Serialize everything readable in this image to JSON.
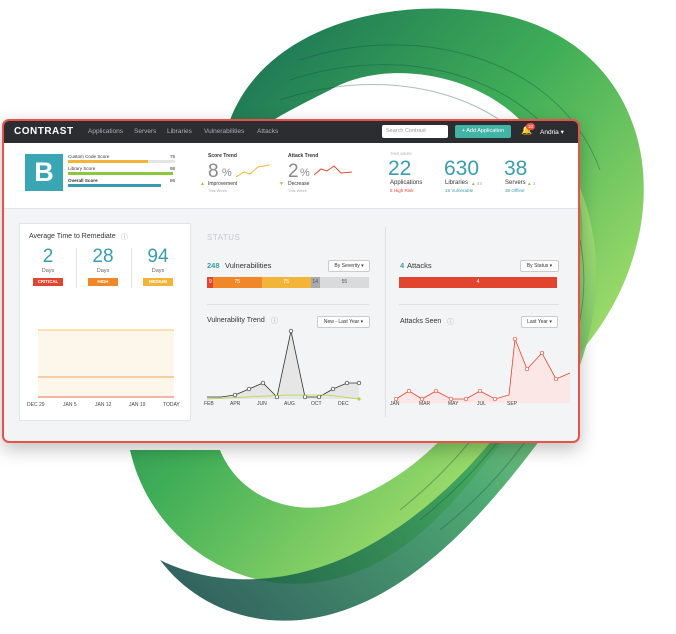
{
  "app": {
    "brand": "CONTRAST"
  },
  "nav": [
    "Applications",
    "Servers",
    "Libraries",
    "Vulnerabilities",
    "Attacks"
  ],
  "search": {
    "placeholder": "Search Contrast"
  },
  "add_button": "+ Add Application",
  "notifications": {
    "count": "10"
  },
  "user": {
    "name": "Andria ▾"
  },
  "scorecard": {
    "grade": "B",
    "rows": [
      {
        "label": "Custom Code Score",
        "value": "75"
      },
      {
        "label": "Library Score",
        "value": "98"
      },
      {
        "label": "Overall Score",
        "value": "86"
      }
    ]
  },
  "score_trend": {
    "title": "Score Trend",
    "value": "8",
    "unit": "%",
    "label": "Improvement",
    "sub": "This Week"
  },
  "attack_trend": {
    "title": "Attack Trend",
    "value": "2",
    "unit": "%",
    "label": "Decrease",
    "sub": "This Week"
  },
  "this_week": {
    "label": "THIS WEEK"
  },
  "stats": {
    "applications": {
      "value": "22",
      "label": "Applications",
      "sub": "5 High Risk"
    },
    "libraries": {
      "value": "630",
      "label": "Libraries",
      "delta": "44",
      "sub": "19 Vulnerable"
    },
    "servers": {
      "value": "38",
      "label": "Servers",
      "delta": "2",
      "sub": "38 Offline"
    }
  },
  "remediate": {
    "title": "Average Time to Remediate",
    "items": [
      {
        "value": "2",
        "unit": "Days",
        "severity": "CRITICAL"
      },
      {
        "value": "28",
        "unit": "Days",
        "severity": "HIGH"
      },
      {
        "value": "94",
        "unit": "Days",
        "severity": "MEDIUM"
      }
    ],
    "x_axis": [
      "DEC 29",
      "JAN 5",
      "JAN 12",
      "JAN 19",
      "TODAY"
    ]
  },
  "status": {
    "label": "STATUS"
  },
  "vulnerabilities": {
    "count": "248",
    "label": "Vulnerabilities",
    "dropdown": "By Severity ▾",
    "segments": [
      {
        "value": "9",
        "share": 0.036,
        "color": "#e2452f"
      },
      {
        "value": "75",
        "share": 0.302,
        "color": "#f0882a"
      },
      {
        "value": "75",
        "share": 0.302,
        "color": "#f2b53a"
      },
      {
        "value": "14",
        "share": 0.056,
        "color": "#a9aaad"
      },
      {
        "value": "55",
        "share": 0.304,
        "color": "#d9dadc"
      }
    ]
  },
  "attacks": {
    "count": "4",
    "label": "Attacks",
    "dropdown": "By Status ▾",
    "bar_value": "4"
  },
  "vuln_trend": {
    "title": "Vulnerability Trend",
    "dropdown": "New - Last Year ▾",
    "x_axis": [
      "FEB",
      "APR",
      "JUN",
      "AUG",
      "OCT",
      "DEC"
    ]
  },
  "attacks_seen": {
    "title": "Attacks Seen",
    "dropdown": "Last Year ▾",
    "x_axis": [
      "JAN",
      "MAR",
      "MAY",
      "JUL",
      "SEP"
    ]
  }
}
